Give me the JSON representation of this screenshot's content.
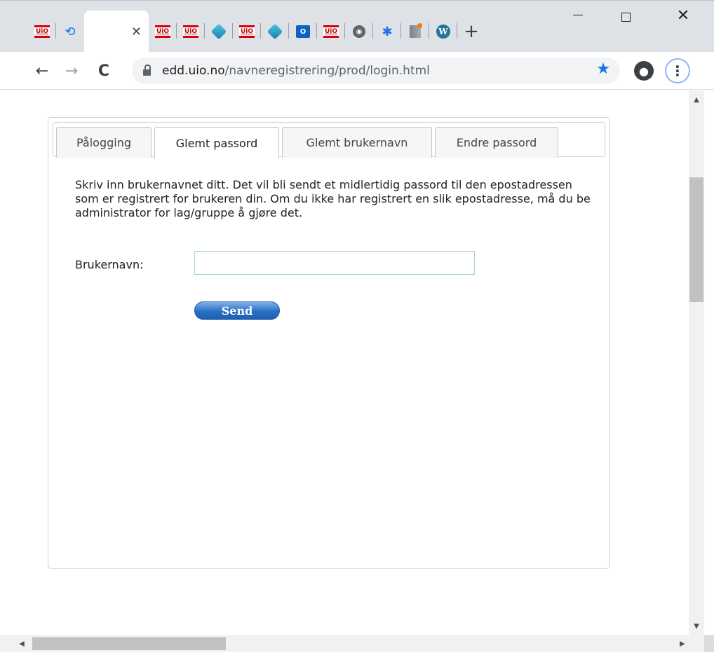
{
  "browser": {
    "pinned_tabs": [
      {
        "icon": "uio-icon",
        "text": "UiO"
      },
      {
        "icon": "history-icon",
        "text": ""
      },
      {
        "icon": "uio-icon",
        "text": "UiO"
      },
      {
        "icon": "uio-icon",
        "text": "UiO"
      },
      {
        "icon": "diamond-icon",
        "text": ""
      },
      {
        "icon": "uio-icon",
        "text": "UiO"
      },
      {
        "icon": "diamond-icon",
        "text": ""
      },
      {
        "icon": "outlook-icon",
        "text": "O"
      },
      {
        "icon": "uio-icon",
        "text": "UiO"
      },
      {
        "icon": "globe-icon",
        "text": ""
      },
      {
        "icon": "gear-icon",
        "text": ""
      },
      {
        "icon": "box-icon",
        "text": ""
      },
      {
        "icon": "wordpress-icon",
        "text": "W"
      }
    ],
    "url_host": "edd.uio.no",
    "url_path": "/navneregistrering/prod/login.html",
    "new_tab_label": "+",
    "window_controls": {
      "minimize": "—",
      "maximize": "☐",
      "close": "✕"
    }
  },
  "page": {
    "tabs": [
      {
        "label": "Pålogging",
        "active": false
      },
      {
        "label": "Glemt passord",
        "active": true
      },
      {
        "label": "Glemt brukernavn",
        "active": false
      },
      {
        "label": "Endre passord",
        "active": false
      }
    ],
    "description": "Skriv inn brukernavnet ditt. Det vil bli sendt et midlertidig passord til den epostadressen som er registrert for brukeren din. Om du ikke har registrert en slik epostadresse, må du be administrator for lag/gruppe å gjøre det.",
    "username_label": "Brukernavn:",
    "username_value": "",
    "send_label": "Send"
  },
  "colors": {
    "accent": "#1a73e8",
    "uio_red": "#d3000f",
    "button_blue": "#2a6fc4"
  }
}
